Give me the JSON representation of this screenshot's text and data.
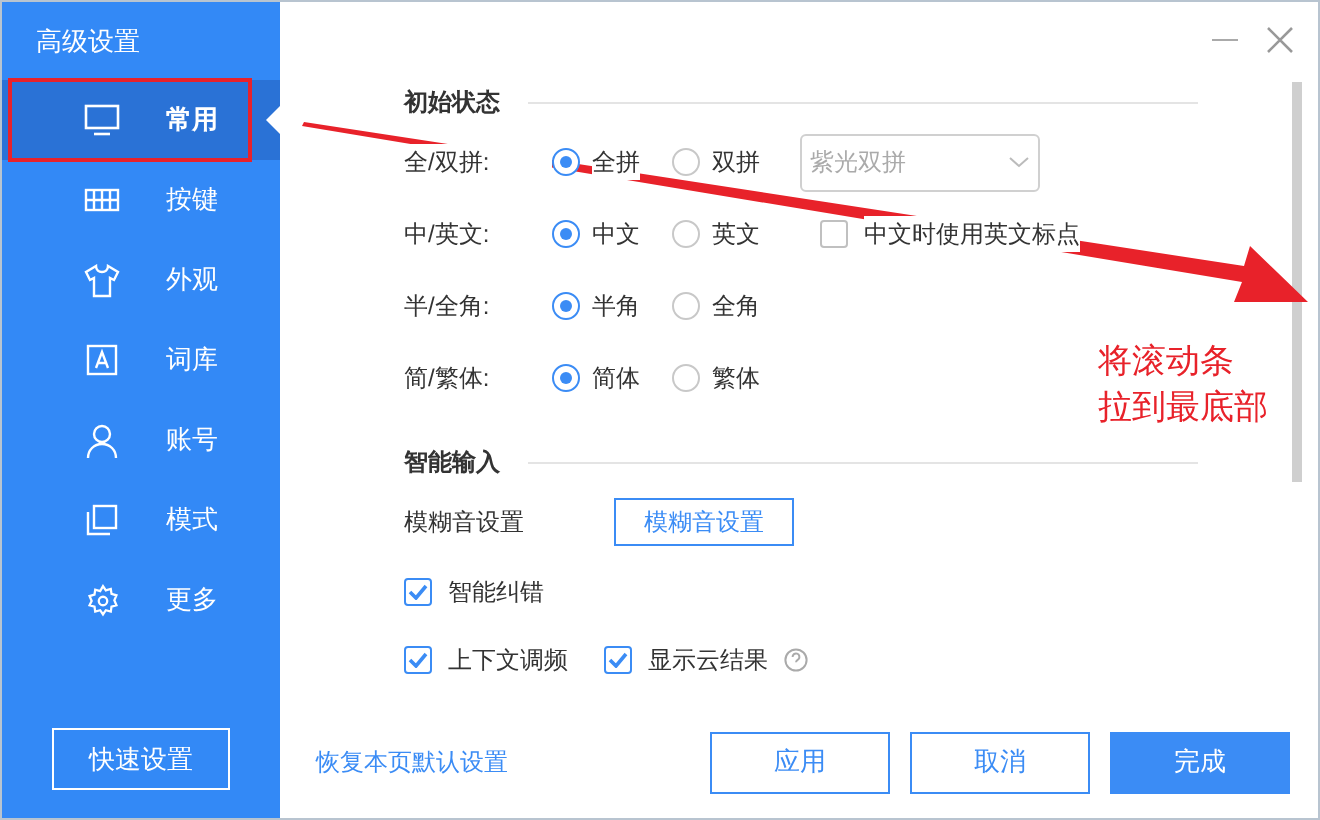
{
  "window": {
    "title": "高级设置"
  },
  "sidebar": {
    "items": [
      {
        "label": "常用",
        "selected": true
      },
      {
        "label": "按键",
        "selected": false
      },
      {
        "label": "外观",
        "selected": false
      },
      {
        "label": "词库",
        "selected": false
      },
      {
        "label": "账号",
        "selected": false
      },
      {
        "label": "模式",
        "selected": false
      },
      {
        "label": "更多",
        "selected": false
      }
    ],
    "quick_button": "快速设置"
  },
  "sections": [
    {
      "title": "初始状态",
      "rows": [
        {
          "kind": "radio",
          "label": "全/双拼:",
          "options": [
            {
              "label": "全拼",
              "selected": true
            },
            {
              "label": "双拼",
              "selected": false
            }
          ],
          "dropdown": {
            "value": "紫光双拼",
            "disabled": true
          }
        },
        {
          "kind": "radio",
          "label": "中/英文:",
          "options": [
            {
              "label": "中文",
              "selected": true
            },
            {
              "label": "英文",
              "selected": false
            }
          ],
          "checkbox": {
            "label": "中文时使用英文标点",
            "checked": false
          }
        },
        {
          "kind": "radio",
          "label": "半/全角:",
          "options": [
            {
              "label": "半角",
              "selected": true
            },
            {
              "label": "全角",
              "selected": false
            }
          ]
        },
        {
          "kind": "radio",
          "label": "简/繁体:",
          "options": [
            {
              "label": "简体",
              "selected": true
            },
            {
              "label": "繁体",
              "selected": false
            }
          ]
        }
      ]
    },
    {
      "title": "智能输入",
      "rows": [
        {
          "kind": "button",
          "label": "模糊音设置",
          "button": "模糊音设置"
        },
        {
          "kind": "checks",
          "items": [
            {
              "label": "智能纠错",
              "checked": true
            }
          ]
        },
        {
          "kind": "checks",
          "items": [
            {
              "label": "上下文调频",
              "checked": true
            },
            {
              "label": "显示云结果",
              "checked": true,
              "help": true
            }
          ]
        }
      ]
    }
  ],
  "footer": {
    "reset_link": "恢复本页默认设置",
    "buttons": [
      {
        "label": "应用",
        "primary": false
      },
      {
        "label": "取消",
        "primary": false
      },
      {
        "label": "完成",
        "primary": true
      }
    ]
  },
  "annotation": {
    "lines": [
      "将滚动条",
      "拉到最底部"
    ]
  }
}
